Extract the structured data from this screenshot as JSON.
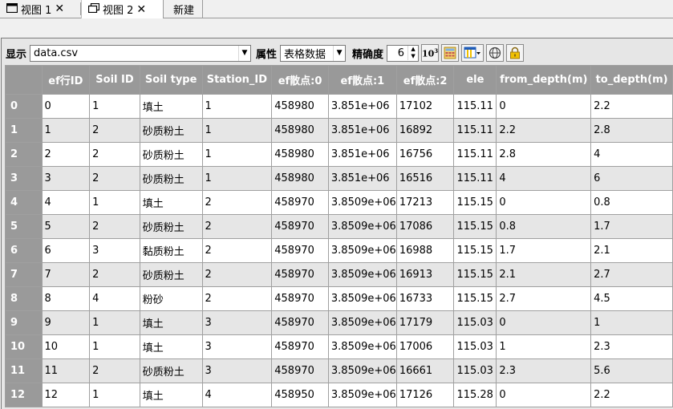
{
  "tabs": [
    {
      "label": "视图 1",
      "icon": "window-icon",
      "active": false
    },
    {
      "label": "视图 2",
      "icon": "window-restore-icon",
      "active": true
    },
    {
      "label": "新建",
      "active": false
    }
  ],
  "toolbar": {
    "display_label": "显示",
    "display_value": "data.csv",
    "attr_label": "属性",
    "attr_value": "表格数据",
    "precision_label": "精确度",
    "precision_value": "6",
    "buttons": [
      "sci-notation-icon",
      "calculator-icon",
      "column-chooser-icon",
      "globe-icon",
      "lock-icon"
    ],
    "accent": "#f0c000"
  },
  "table": {
    "columns": [
      "ef行ID",
      "Soil ID",
      "Soil type",
      "Station_ID",
      "ef散点:0",
      "ef散点:1",
      "ef散点:2",
      "ele",
      "from_depth(m)",
      "to_depth(m)"
    ],
    "row_headers": [
      "0",
      "1",
      "2",
      "3",
      "4",
      "5",
      "6",
      "7",
      "8",
      "9",
      "10",
      "11",
      "12"
    ],
    "rows": [
      [
        "0",
        "1",
        "填土",
        "1",
        "458980",
        "3.851e+06",
        "17102",
        "115.11",
        "0",
        "2.2"
      ],
      [
        "1",
        "2",
        "砂质粉土",
        "1",
        "458980",
        "3.851e+06",
        "16892",
        "115.11",
        "2.2",
        "2.8"
      ],
      [
        "2",
        "2",
        "砂质粉土",
        "1",
        "458980",
        "3.851e+06",
        "16756",
        "115.11",
        "2.8",
        "4"
      ],
      [
        "3",
        "2",
        "砂质粉土",
        "1",
        "458980",
        "3.851e+06",
        "16516",
        "115.11",
        "4",
        "6"
      ],
      [
        "4",
        "1",
        "填土",
        "2",
        "458970",
        "3.8509e+06",
        "17213",
        "115.15",
        "0",
        "0.8"
      ],
      [
        "5",
        "2",
        "砂质粉土",
        "2",
        "458970",
        "3.8509e+06",
        "17086",
        "115.15",
        "0.8",
        "1.7"
      ],
      [
        "6",
        "3",
        "黏质粉土",
        "2",
        "458970",
        "3.8509e+06",
        "16988",
        "115.15",
        "1.7",
        "2.1"
      ],
      [
        "7",
        "2",
        "砂质粉土",
        "2",
        "458970",
        "3.8509e+06",
        "16913",
        "115.15",
        "2.1",
        "2.7"
      ],
      [
        "8",
        "4",
        "粉砂",
        "2",
        "458970",
        "3.8509e+06",
        "16733",
        "115.15",
        "2.7",
        "4.5"
      ],
      [
        "9",
        "1",
        "填土",
        "3",
        "458970",
        "3.8509e+06",
        "17179",
        "115.03",
        "0",
        "1"
      ],
      [
        "10",
        "1",
        "填土",
        "3",
        "458970",
        "3.8509e+06",
        "17006",
        "115.03",
        "1",
        "2.3"
      ],
      [
        "11",
        "2",
        "砂质粉土",
        "3",
        "458970",
        "3.8509e+06",
        "16661",
        "115.03",
        "2.3",
        "5.6"
      ],
      [
        "12",
        "1",
        "填土",
        "4",
        "458950",
        "3.8509e+06",
        "17126",
        "115.28",
        "0",
        "2.2"
      ]
    ]
  }
}
